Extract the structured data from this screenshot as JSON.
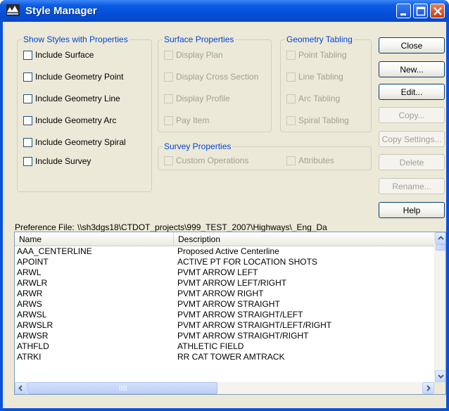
{
  "window": {
    "title": "Style Manager"
  },
  "groups": {
    "show_styles": {
      "legend": "Show Styles with Properties",
      "items": [
        "Include Surface",
        "Include Geometry Point",
        "Include Geometry Line",
        "Include Geometry Arc",
        "Include Geometry Spiral",
        "Include Survey"
      ]
    },
    "surface": {
      "legend": "Surface Properties",
      "items": [
        "Display Plan",
        "Display Cross Section",
        "Display Profile",
        "Pay Item"
      ]
    },
    "geometry_tabling": {
      "legend": "Geometry Tabling",
      "items": [
        "Point Tabling",
        "Line Tabling",
        "Arc Tabling",
        "Spiral Tabling"
      ]
    },
    "survey": {
      "legend": "Survey Properties",
      "items": [
        "Custom Operations",
        "Attributes"
      ]
    }
  },
  "buttons": {
    "close": "Close",
    "new": "New...",
    "edit": "Edit...",
    "copy": "Copy...",
    "copy_settings": "Copy Settings...",
    "delete": "Delete",
    "rename": "Rename...",
    "help": "Help"
  },
  "preference": {
    "label": "Preference File:",
    "path": "\\\\sh3dgs18\\CTDOT_projects\\999_TEST_2007\\Highways\\_Eng_Da"
  },
  "list": {
    "columns": [
      "Name",
      "Description"
    ],
    "rows": [
      [
        "AAA_CENTERLINE",
        "Proposed  Active Centerline"
      ],
      [
        "APOINT",
        "ACTIVE PT FOR LOCATION SHOTS"
      ],
      [
        "ARWL",
        "PVMT ARROW LEFT"
      ],
      [
        "ARWLR",
        "PVMT ARROW LEFT/RIGHT"
      ],
      [
        "ARWR",
        "PVMT ARROW RIGHT"
      ],
      [
        "ARWS",
        "PVMT ARROW STRAIGHT"
      ],
      [
        "ARWSL",
        "PVMT ARROW STRAIGHT/LEFT"
      ],
      [
        "ARWSLR",
        "PVMT ARROW STRAIGHT/LEFT/RIGHT"
      ],
      [
        "ARWSR",
        "PVMT ARROW STRAIGHT/RIGHT"
      ],
      [
        "ATHFLD",
        "ATHLETIC FIELD"
      ],
      [
        "ATRKI",
        "RR CAT TOWER AMTRACK"
      ]
    ]
  }
}
